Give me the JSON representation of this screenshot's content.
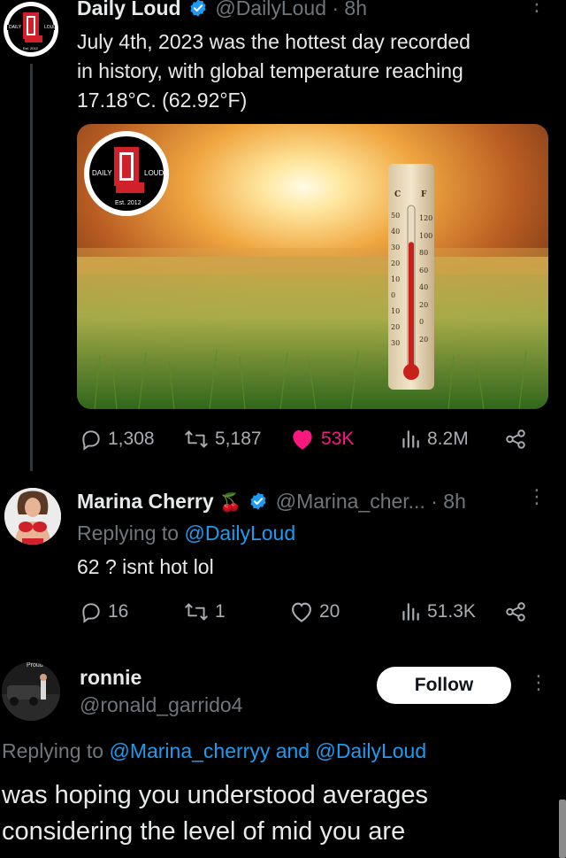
{
  "tweet": {
    "author_name": "Daily Loud",
    "handle": "@DailyLoud",
    "time": "· 8h",
    "text_lines": [
      "July 4th, 2023 was the hottest day recorded",
      "in history, with global temperature reaching",
      "17.18°C. (62.92°F)"
    ],
    "logo_text": {
      "left": "DAILY",
      "right": "LOUD",
      "est": "Est. 2012",
      "mark": "DL"
    },
    "media": {
      "logo_text": {
        "left": "DAILY",
        "right": "LOUD",
        "est": "Est. 2012"
      },
      "thermometer": {
        "c_label": "C",
        "f_label": "F",
        "c_ticks": [
          "50",
          "40",
          "30",
          "20",
          "10",
          "0",
          "10",
          "20",
          "30"
        ],
        "f_ticks": [
          "120",
          "100",
          "80",
          "60",
          "40",
          "20",
          "0",
          "20"
        ],
        "fill_fraction": 0.78
      }
    },
    "stats": {
      "replies": "1,308",
      "retweets": "5,187",
      "likes": "53K",
      "views": "8.2M"
    }
  },
  "reply1": {
    "author_name": "Marina Cherry",
    "emoji": "🍒",
    "handle": "@Marina_cher...",
    "time": "· 8h",
    "replying_prefix": "Replying to",
    "replying_to": "@DailyLoud",
    "text": "62 ? isnt hot lol",
    "stats": {
      "replies": "16",
      "retweets": "1",
      "likes": "20",
      "views": "51.3K"
    }
  },
  "reply2": {
    "author_name": "ronnie",
    "handle": "@ronald_garrido4",
    "avatar_caption": "Proud",
    "follow_label": "Follow",
    "replying_prefix": "Replying to",
    "replying_to_1": "@Marina_cherryy",
    "replying_and": "and",
    "replying_to_2": "@DailyLoud",
    "text_lines": [
      "was hoping you understood averages",
      "considering the level of mid you are"
    ]
  },
  "colors": {
    "background": "#000000",
    "text": "#e7e9ea",
    "muted": "#71767b",
    "link": "#1d9bf0",
    "like_active": "#f91880",
    "verified": "#1d9bf0",
    "brand_red": "#d0202a"
  }
}
